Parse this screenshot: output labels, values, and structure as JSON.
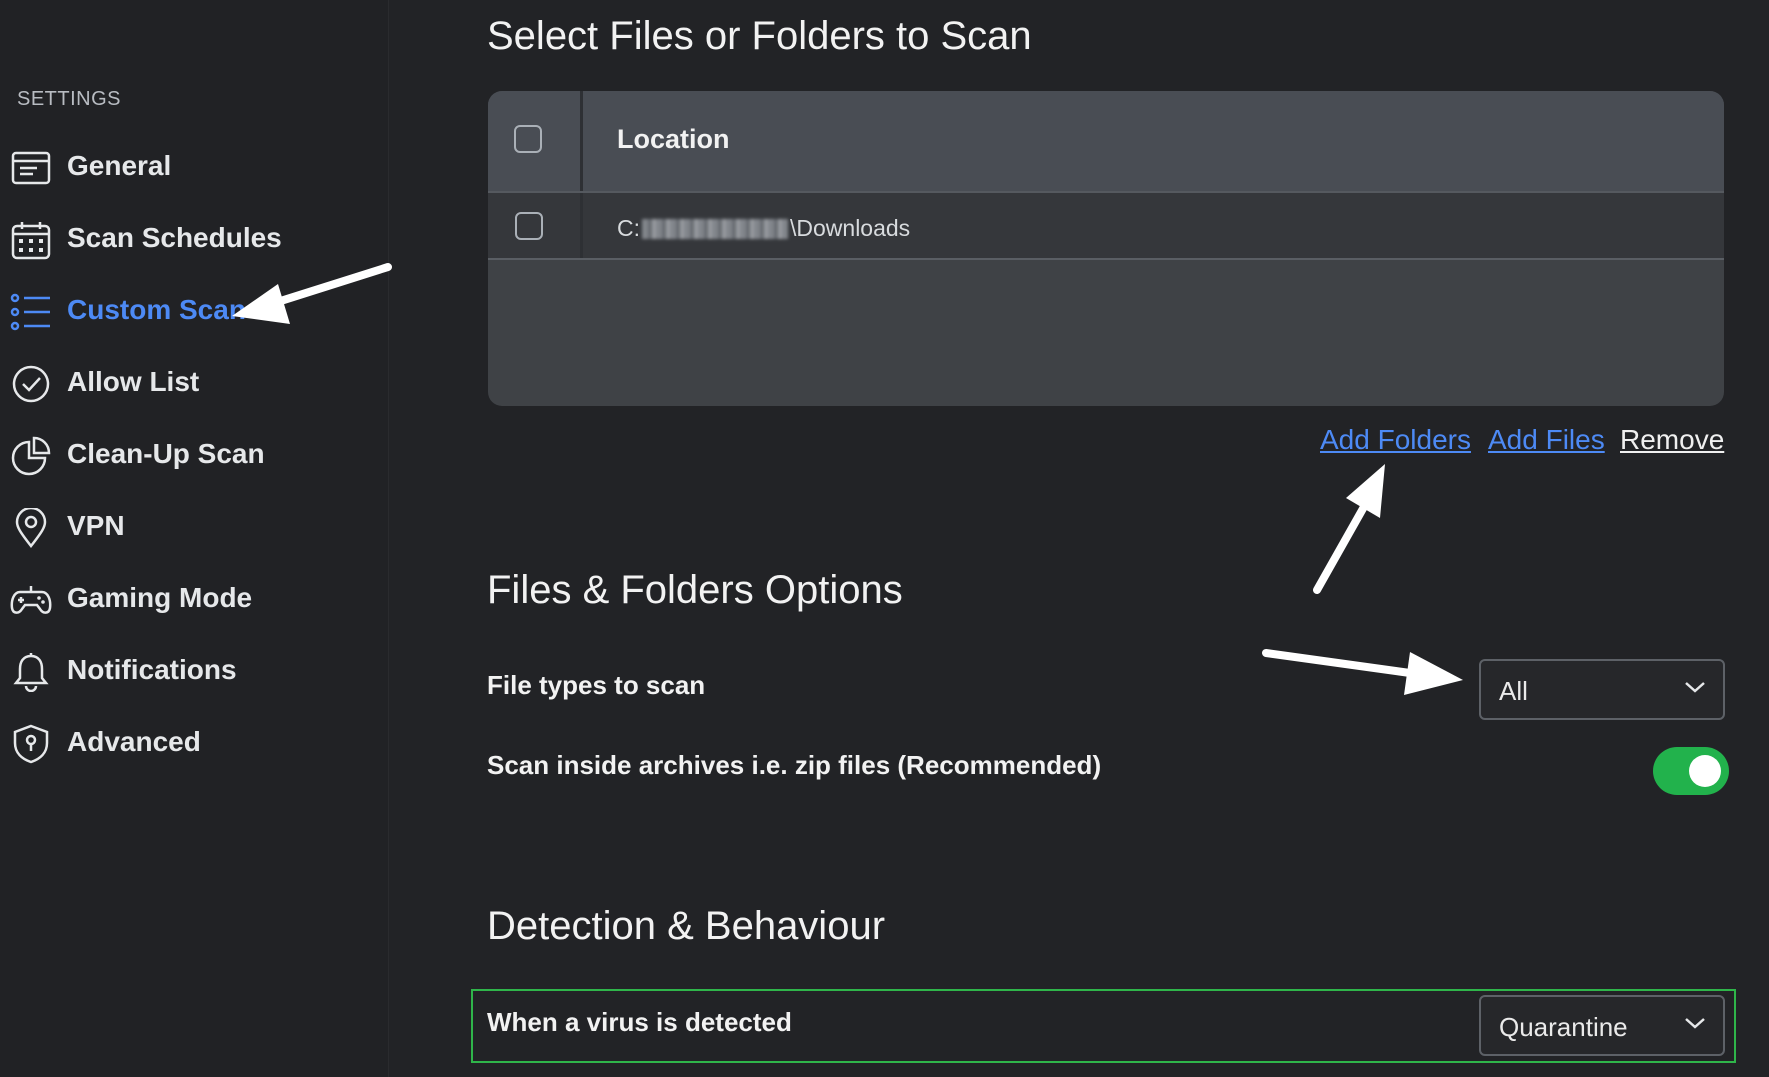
{
  "sidebar": {
    "heading": "SETTINGS",
    "items": [
      {
        "label": "General",
        "icon": "window-icon",
        "active": false
      },
      {
        "label": "Scan Schedules",
        "icon": "calendar-icon",
        "active": false
      },
      {
        "label": "Custom Scan",
        "icon": "list-icon",
        "active": true
      },
      {
        "label": "Allow List",
        "icon": "check-circle-icon",
        "active": false
      },
      {
        "label": "Clean-Up Scan",
        "icon": "pie-chart-icon",
        "active": false
      },
      {
        "label": "VPN",
        "icon": "location-pin-icon",
        "active": false
      },
      {
        "label": "Gaming Mode",
        "icon": "gamepad-icon",
        "active": false
      },
      {
        "label": "Notifications",
        "icon": "bell-icon",
        "active": false
      },
      {
        "label": "Advanced",
        "icon": "shield-icon",
        "active": false
      }
    ]
  },
  "select_section": {
    "title": "Select Files or Folders to Scan",
    "table": {
      "column_header": "Location",
      "rows": [
        {
          "path_prefix": "C:",
          "path_suffix": "\\Downloads",
          "checked": false
        }
      ]
    },
    "actions": {
      "add_folders": "Add Folders",
      "add_files": "Add Files",
      "remove": "Remove"
    }
  },
  "options_section": {
    "title": "Files & Folders Options",
    "file_types_label": "File types to scan",
    "file_types_value": "All",
    "archives_label": "Scan inside archives i.e. zip files (Recommended)",
    "archives_enabled": true
  },
  "detection_section": {
    "title": "Detection & Behaviour",
    "virus_label": "When a virus is detected",
    "virus_action": "Quarantine"
  },
  "colors": {
    "accent": "#4d8af5",
    "toggle_on": "#22b24c",
    "highlight_border": "#2fb54a"
  }
}
